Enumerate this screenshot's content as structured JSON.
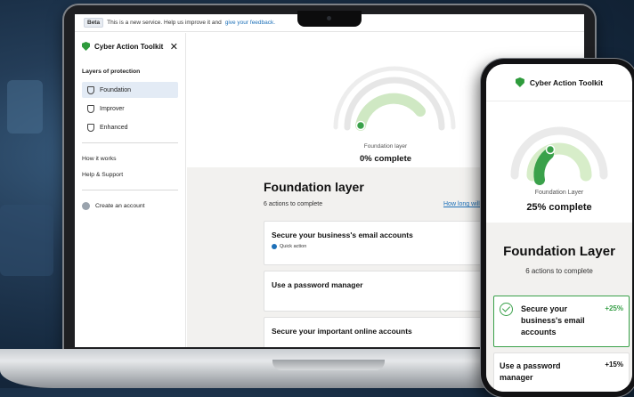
{
  "beta": {
    "tag": "Beta",
    "text": "This is a new service. Help us improve it and",
    "link": "give your feedback."
  },
  "sidebar": {
    "title": "Cyber Action Toolkit",
    "close": "✕",
    "section": "Layers of protection",
    "items": [
      {
        "label": "Foundation",
        "active": true
      },
      {
        "label": "Improver",
        "active": false
      },
      {
        "label": "Enhanced",
        "active": false
      }
    ],
    "links": [
      "How it works",
      "Help & Support"
    ],
    "account": "Create an account"
  },
  "gauge": {
    "label": "Foundation layer",
    "percent_text": "0% complete",
    "progress": 0
  },
  "foundation": {
    "title": "Foundation layer",
    "subtitle": "6 actions to complete",
    "link": "How long will t",
    "cards": [
      {
        "title": "Secure your business's email accounts",
        "tag": "Quick action"
      },
      {
        "title": "Use a password manager"
      },
      {
        "title": "Secure your important online accounts"
      }
    ]
  },
  "phone": {
    "header": "Cyber Action Toolkit",
    "gauge_label": "Foundation Layer",
    "gauge_pct": "25% complete",
    "progress": 0.25,
    "title": "Foundation Layer",
    "subtitle": "6 actions to complete",
    "card1": {
      "title": "Secure your business's email accounts",
      "badge": "+25%"
    },
    "card2": {
      "title": "Use a password manager",
      "badge": "+15%"
    }
  },
  "colors": {
    "accent_green": "#3aa14a",
    "light_green": "#c8e6b8",
    "link_blue": "#1d70b8",
    "track": "#e8e8e8"
  }
}
